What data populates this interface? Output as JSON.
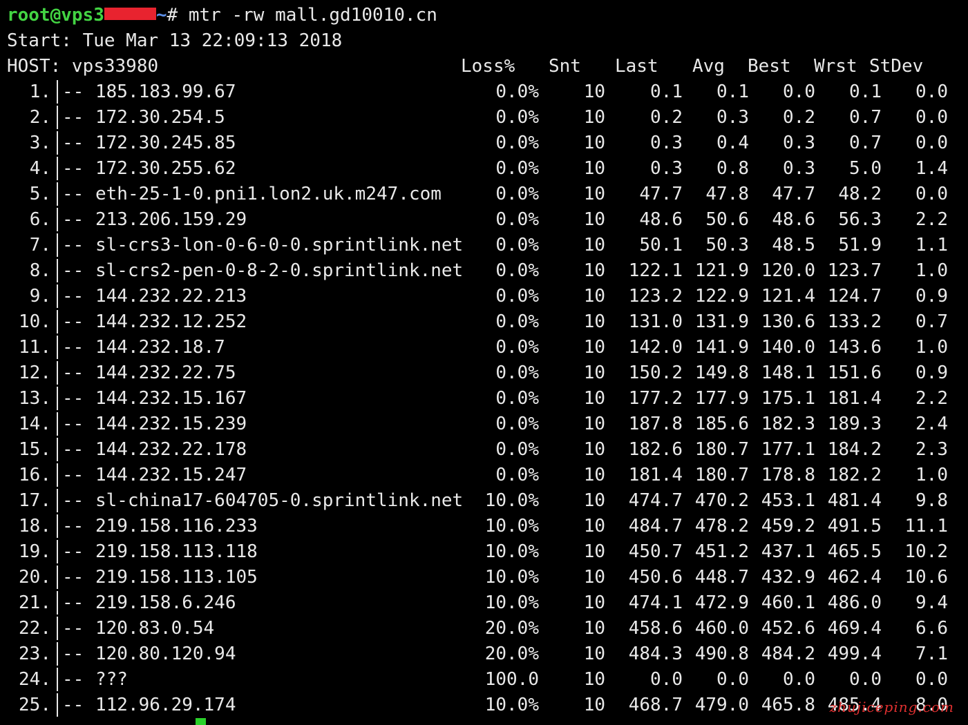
{
  "prompt": {
    "user": "root@vps3",
    "path": "~",
    "symbol": "#",
    "command": "mtr -rw mall.gd10010.cn"
  },
  "start_line": "Start: Tue Mar 13 22:09:13 2018",
  "header": {
    "host_label": "HOST: vps33980",
    "loss": "Loss%",
    "snt": "Snt",
    "last": "Last",
    "avg": "Avg",
    "best": "Best",
    "wrst": "Wrst",
    "stdev": "StDev"
  },
  "hops": [
    {
      "n": "1.",
      "host": "185.183.99.67",
      "loss": "0.0%",
      "snt": "10",
      "last": "0.1",
      "avg": "0.1",
      "best": "0.0",
      "wrst": "0.1",
      "stdev": "0.0"
    },
    {
      "n": "2.",
      "host": "172.30.254.5",
      "loss": "0.0%",
      "snt": "10",
      "last": "0.2",
      "avg": "0.3",
      "best": "0.2",
      "wrst": "0.7",
      "stdev": "0.0"
    },
    {
      "n": "3.",
      "host": "172.30.245.85",
      "loss": "0.0%",
      "snt": "10",
      "last": "0.3",
      "avg": "0.4",
      "best": "0.3",
      "wrst": "0.7",
      "stdev": "0.0"
    },
    {
      "n": "4.",
      "host": "172.30.255.62",
      "loss": "0.0%",
      "snt": "10",
      "last": "0.3",
      "avg": "0.8",
      "best": "0.3",
      "wrst": "5.0",
      "stdev": "1.4"
    },
    {
      "n": "5.",
      "host": "eth-25-1-0.pni1.lon2.uk.m247.com",
      "loss": "0.0%",
      "snt": "10",
      "last": "47.7",
      "avg": "47.8",
      "best": "47.7",
      "wrst": "48.2",
      "stdev": "0.0"
    },
    {
      "n": "6.",
      "host": "213.206.159.29",
      "loss": "0.0%",
      "snt": "10",
      "last": "48.6",
      "avg": "50.6",
      "best": "48.6",
      "wrst": "56.3",
      "stdev": "2.2"
    },
    {
      "n": "7.",
      "host": "sl-crs3-lon-0-6-0-0.sprintlink.net",
      "loss": "0.0%",
      "snt": "10",
      "last": "50.1",
      "avg": "50.3",
      "best": "48.5",
      "wrst": "51.9",
      "stdev": "1.1"
    },
    {
      "n": "8.",
      "host": "sl-crs2-pen-0-8-2-0.sprintlink.net",
      "loss": "0.0%",
      "snt": "10",
      "last": "122.1",
      "avg": "121.9",
      "best": "120.0",
      "wrst": "123.7",
      "stdev": "1.0"
    },
    {
      "n": "9.",
      "host": "144.232.22.213",
      "loss": "0.0%",
      "snt": "10",
      "last": "123.2",
      "avg": "122.9",
      "best": "121.4",
      "wrst": "124.7",
      "stdev": "0.9"
    },
    {
      "n": "10.",
      "host": "144.232.12.252",
      "loss": "0.0%",
      "snt": "10",
      "last": "131.0",
      "avg": "131.9",
      "best": "130.6",
      "wrst": "133.2",
      "stdev": "0.7"
    },
    {
      "n": "11.",
      "host": "144.232.18.7",
      "loss": "0.0%",
      "snt": "10",
      "last": "142.0",
      "avg": "141.9",
      "best": "140.0",
      "wrst": "143.6",
      "stdev": "1.0"
    },
    {
      "n": "12.",
      "host": "144.232.22.75",
      "loss": "0.0%",
      "snt": "10",
      "last": "150.2",
      "avg": "149.8",
      "best": "148.1",
      "wrst": "151.6",
      "stdev": "0.9"
    },
    {
      "n": "13.",
      "host": "144.232.15.167",
      "loss": "0.0%",
      "snt": "10",
      "last": "177.2",
      "avg": "177.9",
      "best": "175.1",
      "wrst": "181.4",
      "stdev": "2.2"
    },
    {
      "n": "14.",
      "host": "144.232.15.239",
      "loss": "0.0%",
      "snt": "10",
      "last": "187.8",
      "avg": "185.6",
      "best": "182.3",
      "wrst": "189.3",
      "stdev": "2.4"
    },
    {
      "n": "15.",
      "host": "144.232.22.178",
      "loss": "0.0%",
      "snt": "10",
      "last": "182.6",
      "avg": "180.7",
      "best": "177.1",
      "wrst": "184.2",
      "stdev": "2.3"
    },
    {
      "n": "16.",
      "host": "144.232.15.247",
      "loss": "0.0%",
      "snt": "10",
      "last": "181.4",
      "avg": "180.7",
      "best": "178.8",
      "wrst": "182.2",
      "stdev": "1.0"
    },
    {
      "n": "17.",
      "host": "sl-china17-604705-0.sprintlink.net",
      "loss": "10.0%",
      "snt": "10",
      "last": "474.7",
      "avg": "470.2",
      "best": "453.1",
      "wrst": "481.4",
      "stdev": "9.8"
    },
    {
      "n": "18.",
      "host": "219.158.116.233",
      "loss": "10.0%",
      "snt": "10",
      "last": "484.7",
      "avg": "478.2",
      "best": "459.2",
      "wrst": "491.5",
      "stdev": "11.1"
    },
    {
      "n": "19.",
      "host": "219.158.113.118",
      "loss": "10.0%",
      "snt": "10",
      "last": "450.7",
      "avg": "451.2",
      "best": "437.1",
      "wrst": "465.5",
      "stdev": "10.2"
    },
    {
      "n": "20.",
      "host": "219.158.113.105",
      "loss": "10.0%",
      "snt": "10",
      "last": "450.6",
      "avg": "448.7",
      "best": "432.9",
      "wrst": "462.4",
      "stdev": "10.6"
    },
    {
      "n": "21.",
      "host": "219.158.6.246",
      "loss": "10.0%",
      "snt": "10",
      "last": "474.1",
      "avg": "472.9",
      "best": "460.1",
      "wrst": "486.0",
      "stdev": "9.4"
    },
    {
      "n": "22.",
      "host": "120.83.0.54",
      "loss": "20.0%",
      "snt": "10",
      "last": "458.6",
      "avg": "460.0",
      "best": "452.6",
      "wrst": "469.4",
      "stdev": "6.6"
    },
    {
      "n": "23.",
      "host": "120.80.120.94",
      "loss": "20.0%",
      "snt": "10",
      "last": "484.3",
      "avg": "490.8",
      "best": "484.2",
      "wrst": "499.4",
      "stdev": "7.1"
    },
    {
      "n": "24.",
      "host": "???",
      "loss": "100.0",
      "snt": "10",
      "last": "0.0",
      "avg": "0.0",
      "best": "0.0",
      "wrst": "0.0",
      "stdev": "0.0"
    },
    {
      "n": "25.",
      "host": "112.96.29.174",
      "loss": "10.0%",
      "snt": "10",
      "last": "468.7",
      "avg": "479.0",
      "best": "465.8",
      "wrst": "485.4",
      "stdev": "8.0"
    }
  ],
  "hop_prefix": "-- ",
  "watermark": "zhujiceping.com",
  "colors": {
    "background": "#000000",
    "text": "#e9e9e9",
    "prompt_user": "#43d443",
    "prompt_path": "#5c8fe8",
    "redaction": "#e8232f",
    "cursor": "#2ad12a"
  }
}
